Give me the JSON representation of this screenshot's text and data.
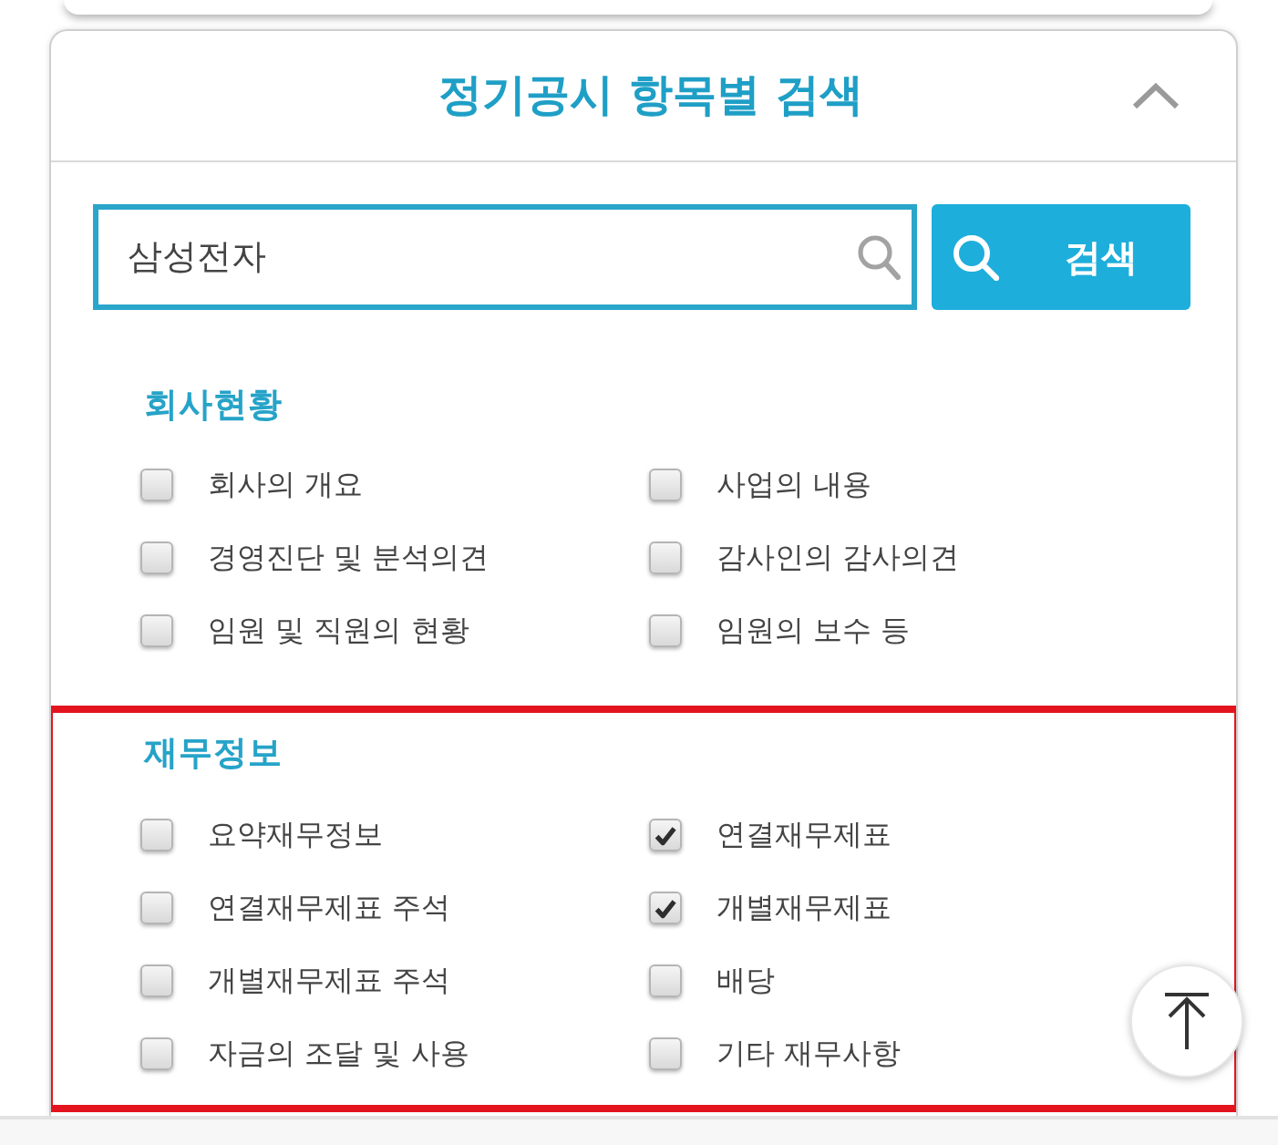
{
  "panel": {
    "title": "정기공시 항목별 검색",
    "expanded": true
  },
  "search": {
    "value": "삼성전자",
    "button": "검색"
  },
  "sections": [
    {
      "heading": "회사현황",
      "highlighted": false,
      "items": [
        {
          "label": "회사의 개요",
          "checked": false
        },
        {
          "label": "사업의 내용",
          "checked": false
        },
        {
          "label": "경영진단 및 분석의견",
          "checked": false
        },
        {
          "label": "감사인의 감사의견",
          "checked": false
        },
        {
          "label": "임원 및 직원의 현황",
          "checked": false
        },
        {
          "label": "임원의 보수 등",
          "checked": false
        }
      ]
    },
    {
      "heading": "재무정보",
      "highlighted": true,
      "items": [
        {
          "label": "요약재무정보",
          "checked": false
        },
        {
          "label": "연결재무제표",
          "checked": true
        },
        {
          "label": "연결재무제표 주석",
          "checked": false
        },
        {
          "label": "개별재무제표",
          "checked": true
        },
        {
          "label": "개별재무제표 주석",
          "checked": false
        },
        {
          "label": "배당",
          "checked": false
        },
        {
          "label": "자금의 조달 및 사용",
          "checked": false
        },
        {
          "label": "기타 재무사항",
          "checked": false
        }
      ]
    }
  ]
}
